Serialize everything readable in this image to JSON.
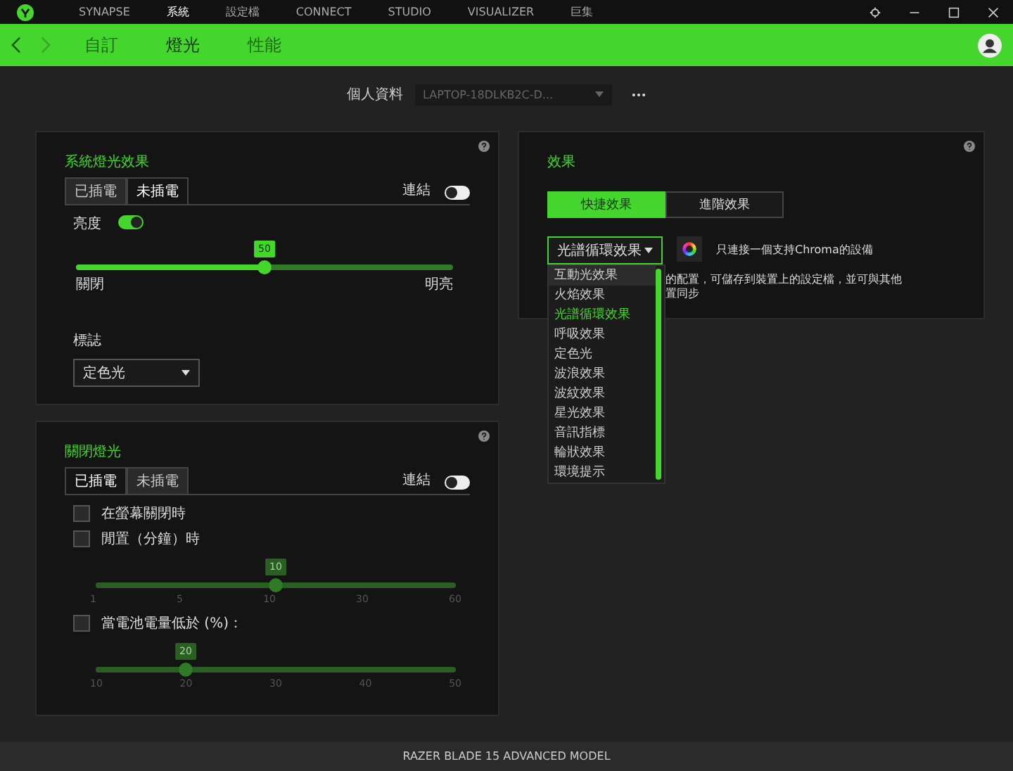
{
  "title_bar": {
    "nav": [
      {
        "label": "SYNAPSE",
        "selected": false
      },
      {
        "label": "系統",
        "selected": true
      },
      {
        "label": "設定檔",
        "selected": false
      },
      {
        "label": "CONNECT",
        "selected": false
      },
      {
        "label": "STUDIO",
        "selected": false
      },
      {
        "label": "VISUALIZER",
        "selected": false
      },
      {
        "label": "巨集",
        "selected": false
      }
    ]
  },
  "sub_nav": {
    "tabs": [
      {
        "label": "自訂",
        "selected": false
      },
      {
        "label": "燈光",
        "selected": true
      },
      {
        "label": "性能",
        "selected": false
      }
    ]
  },
  "profile": {
    "label": "個人資料",
    "value": "LAPTOP-18DLKB2C-D..."
  },
  "system_lighting": {
    "title": "系統燈光效果",
    "tabs": [
      {
        "label": "已插電",
        "selected": false
      },
      {
        "label": "未插電",
        "selected": true
      }
    ],
    "link": {
      "label": "連結",
      "on": false
    },
    "brightness": {
      "label": "亮度",
      "on": true,
      "level": 0.5,
      "reading": "50",
      "min_label": "關閉",
      "max_label": "明亮"
    },
    "logo": {
      "label": "標誌",
      "value": "定色光"
    }
  },
  "lighting_off": {
    "title": "關閉燈光",
    "tabs": [
      {
        "label": "已插電",
        "selected": true
      },
      {
        "label": "未插電",
        "selected": false
      }
    ],
    "link": {
      "label": "連結",
      "on": false
    },
    "items": [
      {
        "kind": "checkbox",
        "label": "在螢幕關閉時",
        "checked": false
      },
      {
        "kind": "checkbox",
        "label": "閒置（分鐘）時",
        "checked": false
      },
      {
        "kind": "slider",
        "disabled": true,
        "level": 0.5,
        "reading": "10",
        "ticks": [
          "1",
          "5",
          "10",
          "30",
          "60"
        ]
      },
      {
        "kind": "checkbox",
        "label": "當電池電量低於 (%)：",
        "checked": false
      },
      {
        "kind": "slider",
        "disabled": true,
        "level": 0.25,
        "reading": "20",
        "ticks": [
          "10",
          "20",
          "30",
          "40",
          "50"
        ]
      }
    ]
  },
  "effects": {
    "title": "效果",
    "modes": [
      {
        "label": "快捷效果",
        "selected": true
      },
      {
        "label": "進階效果",
        "selected": false
      }
    ],
    "effect_select": {
      "value": "光譜循環效果",
      "expanded": true,
      "options": [
        {
          "label": "互動光效果",
          "selected": false,
          "hovered": true
        },
        {
          "label": "火焰效果",
          "selected": false,
          "hovered": false
        },
        {
          "label": "光譜循環效果",
          "selected": true,
          "hovered": false
        },
        {
          "label": "呼吸效果",
          "selected": false,
          "hovered": false
        },
        {
          "label": "定色光",
          "selected": false,
          "hovered": false
        },
        {
          "label": "波浪效果",
          "selected": false,
          "hovered": false
        },
        {
          "label": "波紋效果",
          "selected": false,
          "hovered": false
        },
        {
          "label": "星光效果",
          "selected": false,
          "hovered": false
        },
        {
          "label": "音訊指標",
          "selected": false,
          "hovered": false
        },
        {
          "label": "輪狀效果",
          "selected": false,
          "hovered": false
        },
        {
          "label": "環境提示",
          "selected": false,
          "hovered": false
        }
      ]
    },
    "chroma_note": "只連接一個支持Chroma的設備",
    "description": [
      "的配置，可儲存到裝置上的設定檔，並可與其他",
      "置同步"
    ]
  },
  "status_bar": {
    "text": "RAZER BLADE 15 ADVANCED MODEL"
  }
}
